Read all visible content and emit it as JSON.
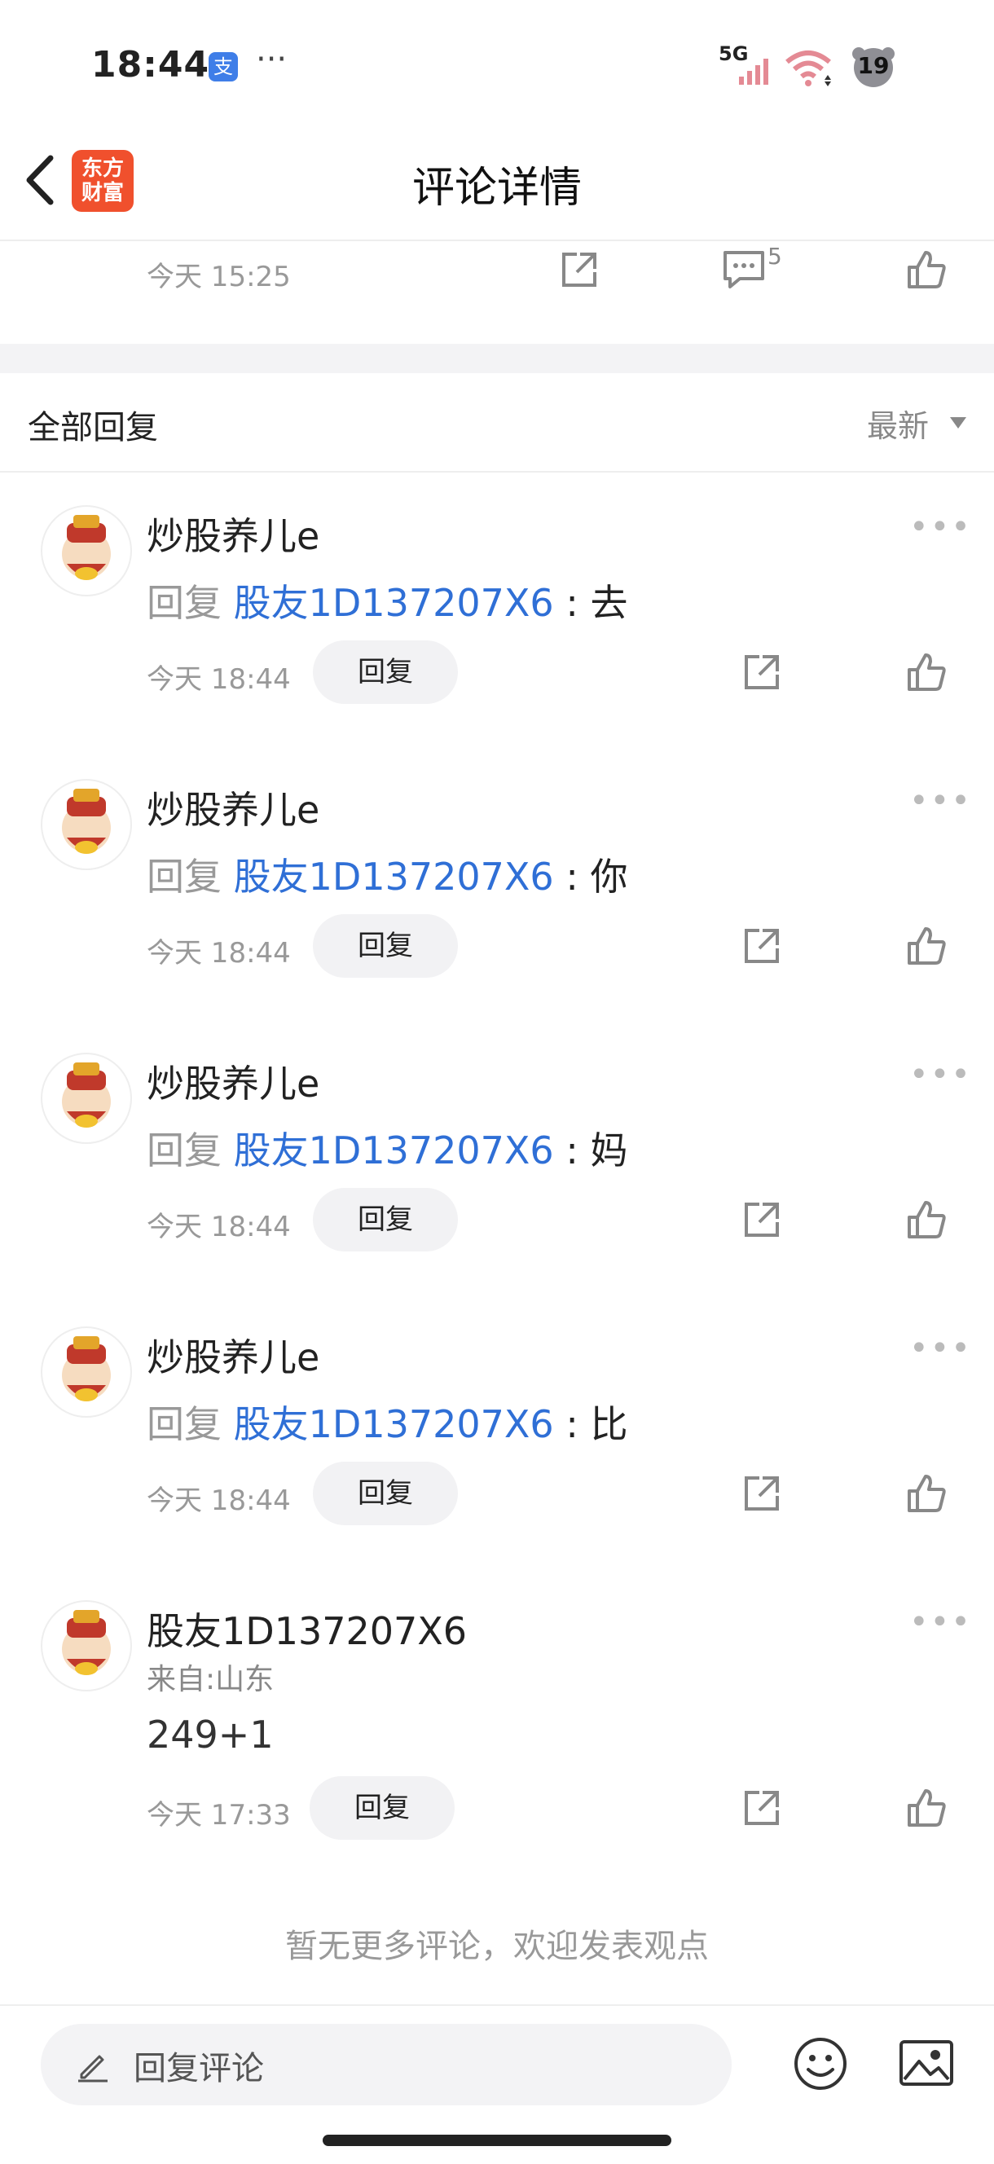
{
  "status_bar": {
    "time": "18:44",
    "app_badge": "支",
    "more": "···",
    "network": "5G",
    "battery": "19"
  },
  "nav": {
    "title": "评论详情",
    "logo_line1": "东方",
    "logo_line2": "财富"
  },
  "parent_comment": {
    "time": "今天 15:25",
    "comment_count": "5"
  },
  "replies_header": {
    "title": "全部回复",
    "sort": "最新"
  },
  "replies": [
    {
      "user": "炒股养儿e",
      "prefix": "回复",
      "target": "股友1D137207X6",
      "separator": ":",
      "text": "去",
      "time": "今天 18:44",
      "reply_label": "回复"
    },
    {
      "user": "炒股养儿e",
      "prefix": "回复",
      "target": "股友1D137207X6",
      "separator": ":",
      "text": "你",
      "time": "今天 18:44",
      "reply_label": "回复"
    },
    {
      "user": "炒股养儿e",
      "prefix": "回复",
      "target": "股友1D137207X6",
      "separator": ":",
      "text": "妈",
      "time": "今天 18:44",
      "reply_label": "回复"
    },
    {
      "user": "炒股养儿e",
      "prefix": "回复",
      "target": "股友1D137207X6",
      "separator": ":",
      "text": "比",
      "time": "今天 18:44",
      "reply_label": "回复"
    }
  ],
  "last_comment": {
    "user": "股友1D137207X6",
    "location": "来自:山东",
    "text": "249+1",
    "time": "今天 17:33",
    "reply_label": "回复"
  },
  "footer_note": "暂无更多评论，欢迎发表观点",
  "bottom_bar": {
    "input_placeholder": "回复评论"
  }
}
